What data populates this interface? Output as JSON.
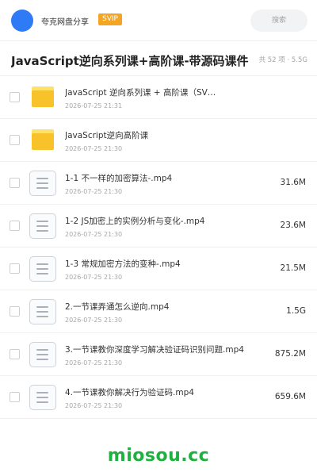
{
  "header": {
    "brand": "夸克网盘分享",
    "badge": "SVIP",
    "search_placeholder": "搜索"
  },
  "share": {
    "title": "JavaScript逆向系列课+高阶课-带源码课件",
    "meta": "共 52 项 · 5.5G"
  },
  "files": [
    {
      "type": "folder",
      "name": "JavaScript 逆向系列课 + 高阶课（SV…",
      "date": "2026-07-25 21:31",
      "size": ""
    },
    {
      "type": "folder",
      "name": "JavaScript逆向高阶课",
      "date": "2026-07-25 21:30",
      "size": ""
    },
    {
      "type": "file",
      "name": "1-1 不一样的加密算法-.mp4",
      "date": "2026-07-25 21:30",
      "size": "31.6M"
    },
    {
      "type": "file",
      "name": "1-2 JS加密上的实例分析与变化-.mp4",
      "date": "2026-07-25 21:30",
      "size": "23.6M"
    },
    {
      "type": "file",
      "name": "1-3 常规加密方法的变种-.mp4",
      "date": "2026-07-25 21:30",
      "size": "21.5M"
    },
    {
      "type": "file",
      "name": "2.一节课弄通怎么逆向.mp4",
      "date": "2026-07-25 21:30",
      "size": "1.5G"
    },
    {
      "type": "file",
      "name": "3.一节课教你深度学习解决验证码识别问题.mp4",
      "date": "2026-07-25 21:30",
      "size": "875.2M"
    },
    {
      "type": "file",
      "name": "4.一节课教你解决行为验证码.mp4",
      "date": "2026-07-25 21:30",
      "size": "659.6M"
    }
  ],
  "watermark": "miosou.cc",
  "colors": {
    "avatar": "#2f7bf5",
    "badge": "#f5a524",
    "folder": "#f7c22a",
    "watermark": "#1fb13f"
  },
  "icons": {
    "folder": "folder-icon",
    "file": "video-file-icon"
  }
}
